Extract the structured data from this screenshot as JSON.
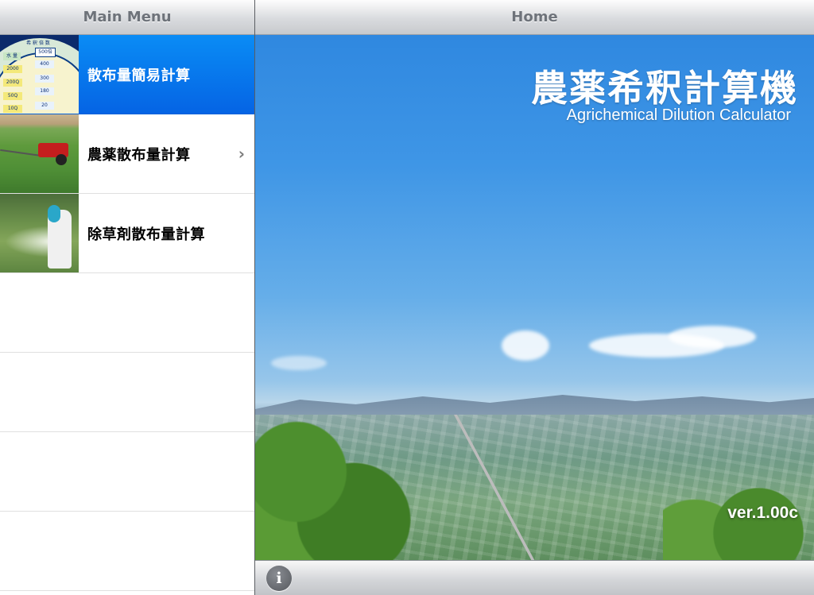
{
  "left_pane": {
    "title": "Main Menu",
    "items": [
      {
        "label": "散布量簡易計算",
        "selected": true,
        "thumb_icon": "dilution-chart-icon",
        "has_chevron": false
      },
      {
        "label": "農薬散布量計算",
        "selected": false,
        "thumb_icon": "tractor-spraying-icon",
        "has_chevron": true
      },
      {
        "label": "除草剤散布量計算",
        "selected": false,
        "thumb_icon": "herbicide-spraying-icon",
        "has_chevron": false
      }
    ],
    "chart_thumb": {
      "header": "希 釈 倍 数",
      "left_label": "水 量",
      "col_header": "500倍",
      "rows": [
        {
          "water": "2000",
          "value": "400"
        },
        {
          "water": "200Q",
          "value": "300"
        },
        {
          "water": "50Q",
          "value": "180"
        },
        {
          "water": "10Q",
          "value": "20"
        }
      ]
    },
    "chevron_glyph": "›"
  },
  "right_pane": {
    "title": "Home",
    "hero_title": "農薬希釈計算機",
    "hero_subtitle": "Agrichemical Dilution Calculator",
    "version": "ver.1.00c",
    "info_glyph": "i"
  },
  "colors": {
    "selected_row": "#0564e4",
    "navbar_text": "#6e737a",
    "sky": "#3f96e6"
  }
}
